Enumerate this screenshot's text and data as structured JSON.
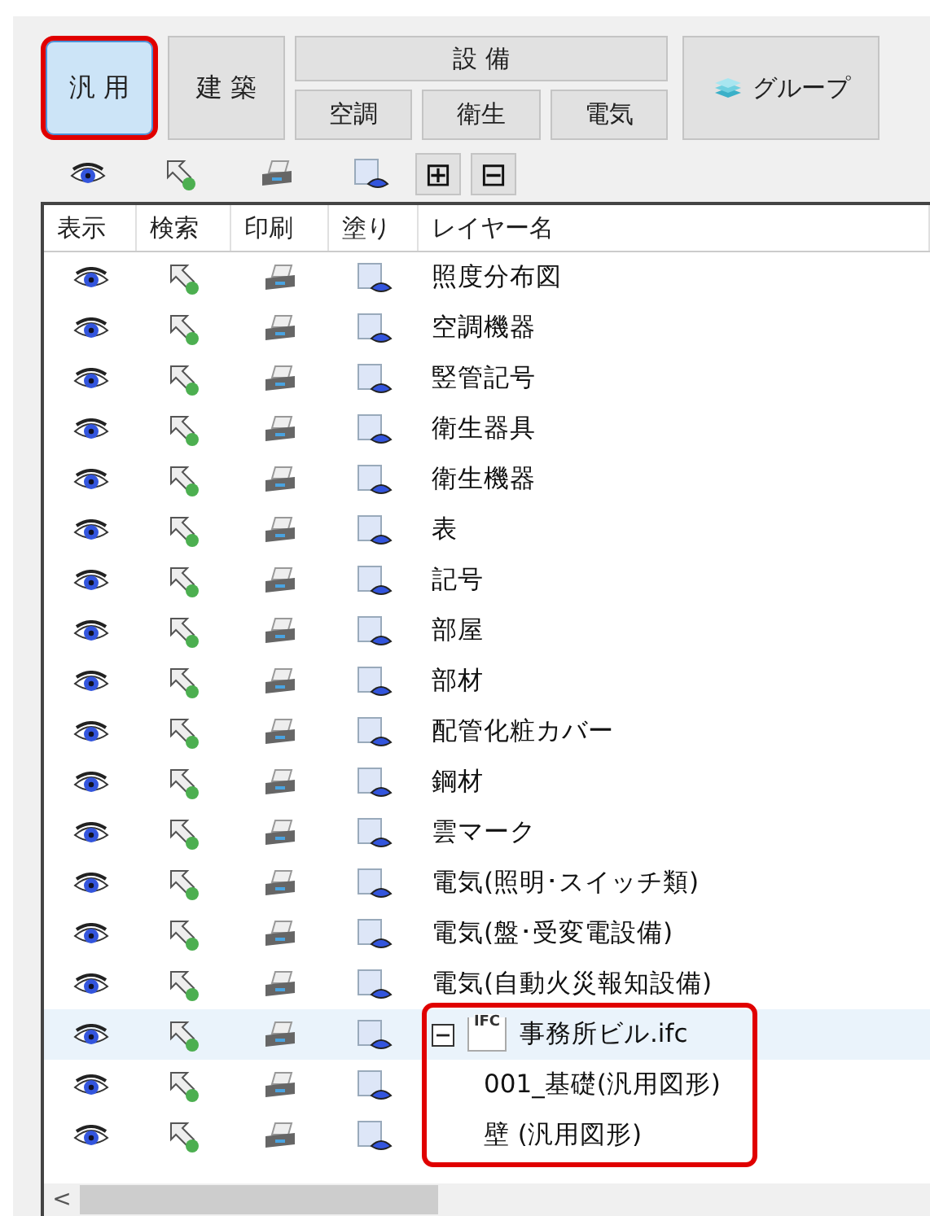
{
  "category_tabs": [
    {
      "label": "汎 用",
      "selected": true,
      "highlighted": true
    },
    {
      "label": "建 築",
      "selected": false,
      "highlighted": false
    }
  ],
  "equipment_group": {
    "label": "設 備",
    "tabs": [
      {
        "label": "空調",
        "selected": false
      },
      {
        "label": "衛生",
        "selected": false
      },
      {
        "label": "電気",
        "selected": false
      }
    ]
  },
  "group_button": {
    "label": "グループ"
  },
  "toolbar": {
    "expand_label": "⊞",
    "collapse_label": "⊟"
  },
  "table": {
    "columns": [
      "表示",
      "検索",
      "印刷",
      "塗り",
      "レイヤー名"
    ],
    "rows": [
      {
        "name": "照度分布図",
        "selected": false
      },
      {
        "name": "空調機器",
        "selected": false
      },
      {
        "name": "竪管記号",
        "selected": false
      },
      {
        "name": "衛生器具",
        "selected": false
      },
      {
        "name": "衛生機器",
        "selected": false
      },
      {
        "name": "表",
        "selected": false
      },
      {
        "name": "記号",
        "selected": false
      },
      {
        "name": "部屋",
        "selected": false
      },
      {
        "name": "部材",
        "selected": false
      },
      {
        "name": "配管化粧カバー",
        "selected": false
      },
      {
        "name": "鋼材",
        "selected": false
      },
      {
        "name": "雲マーク",
        "selected": false
      },
      {
        "name": "電気(照明･スイッチ類)",
        "selected": false
      },
      {
        "name": "電気(盤･受変電設備)",
        "selected": false
      },
      {
        "name": "電気(自動火災報知設備)",
        "selected": false
      },
      {
        "name": "事務所ビル.ifc",
        "selected": true,
        "kind": "file",
        "file_badge": "IFC",
        "expanded": true,
        "highlighted": true,
        "children": [
          {
            "name": "001_基礎(汎用図形)",
            "selected": false
          },
          {
            "name": "壁 (汎用図形)",
            "selected": false
          }
        ]
      }
    ]
  },
  "scrollbar": {
    "left_arrow": "<"
  }
}
